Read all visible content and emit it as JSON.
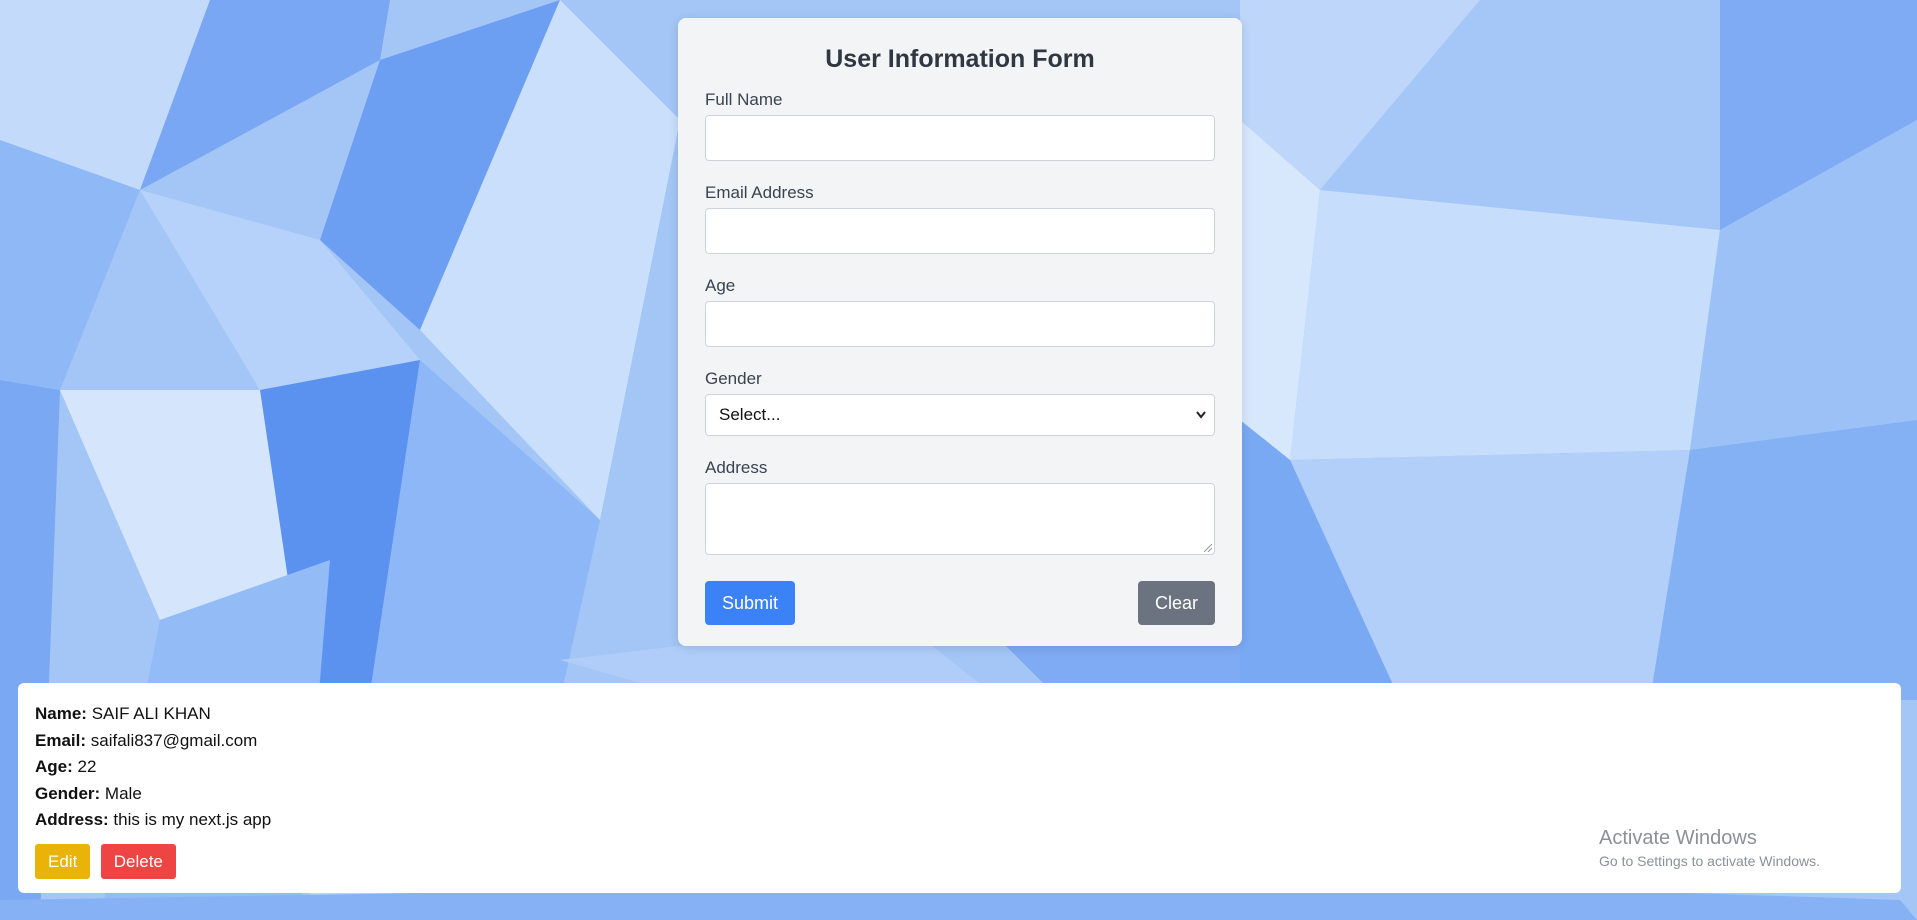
{
  "form": {
    "title": "User Information Form",
    "fields": {
      "full_name": {
        "label": "Full Name",
        "value": ""
      },
      "email": {
        "label": "Email Address",
        "value": ""
      },
      "age": {
        "label": "Age",
        "value": ""
      },
      "gender": {
        "label": "Gender",
        "selected": "Select..."
      },
      "address": {
        "label": "Address",
        "value": ""
      }
    },
    "submit_label": "Submit",
    "clear_label": "Clear"
  },
  "entry": {
    "name_label": "Name:",
    "name": "SAIF ALI KHAN",
    "email_label": "Email:",
    "email": "saifali837@gmail.com",
    "age_label": "Age:",
    "age": "22",
    "gender_label": "Gender:",
    "gender": "Male",
    "address_label": "Address:",
    "address": "this is my next.js app",
    "edit_label": "Edit",
    "delete_label": "Delete"
  },
  "watermark": {
    "title": "Activate Windows",
    "subtitle": "Go to Settings to activate Windows."
  },
  "colors": {
    "primary": "#3b82f6",
    "secondary": "#6b7280",
    "edit": "#eab308",
    "delete": "#ef4444",
    "card": "#f2f4f6"
  },
  "icons": {
    "select_chevron": "chevron-down-icon",
    "textarea_resize": "resize-grip-icon"
  }
}
